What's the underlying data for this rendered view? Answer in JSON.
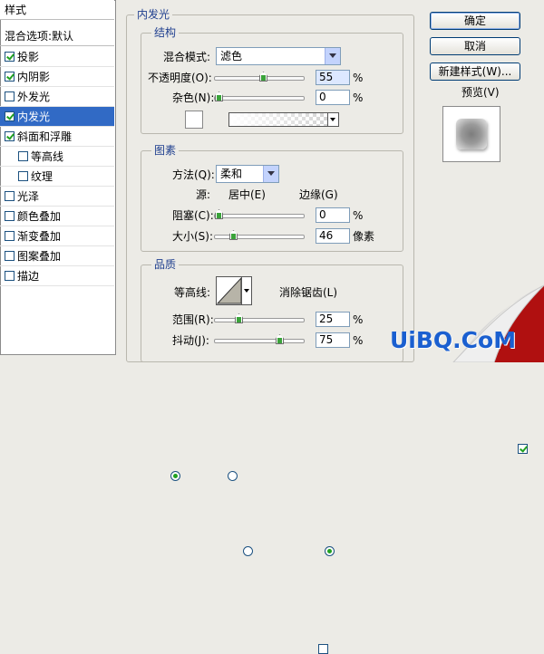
{
  "styles_panel": {
    "header": "样式",
    "items": [
      {
        "label": "混合选项:默认",
        "checkbox": false,
        "has_checkbox": false,
        "indent": false,
        "selected": false
      },
      {
        "label": "投影",
        "checkbox": true,
        "has_checkbox": true,
        "indent": false,
        "selected": false
      },
      {
        "label": "内阴影",
        "checkbox": true,
        "has_checkbox": true,
        "indent": false,
        "selected": false
      },
      {
        "label": "外发光",
        "checkbox": false,
        "has_checkbox": true,
        "indent": false,
        "selected": false
      },
      {
        "label": "内发光",
        "checkbox": true,
        "has_checkbox": true,
        "indent": false,
        "selected": true
      },
      {
        "label": "斜面和浮雕",
        "checkbox": true,
        "has_checkbox": true,
        "indent": false,
        "selected": false
      },
      {
        "label": "等高线",
        "checkbox": false,
        "has_checkbox": true,
        "indent": true,
        "selected": false
      },
      {
        "label": "纹理",
        "checkbox": false,
        "has_checkbox": true,
        "indent": true,
        "selected": false
      },
      {
        "label": "光泽",
        "checkbox": false,
        "has_checkbox": true,
        "indent": false,
        "selected": false
      },
      {
        "label": "颜色叠加",
        "checkbox": false,
        "has_checkbox": true,
        "indent": false,
        "selected": false
      },
      {
        "label": "渐变叠加",
        "checkbox": false,
        "has_checkbox": true,
        "indent": false,
        "selected": false
      },
      {
        "label": "图案叠加",
        "checkbox": false,
        "has_checkbox": true,
        "indent": false,
        "selected": false
      },
      {
        "label": "描边",
        "checkbox": false,
        "has_checkbox": true,
        "indent": false,
        "selected": false
      }
    ]
  },
  "inner_glow": {
    "title": "内发光",
    "structure": {
      "title": "结构",
      "blend_mode_label": "混合模式:",
      "blend_mode_value": "滤色",
      "opacity_label": "不透明度(O):",
      "opacity_value": "55",
      "opacity_unit": "%",
      "opacity_level": 0.55,
      "noise_label": "杂色(N):",
      "noise_value": "0",
      "noise_unit": "%",
      "noise_level": 0
    },
    "elements": {
      "title": "图素",
      "method_label": "方法(Q):",
      "method_value": "柔和",
      "source_label": "源:",
      "source_center": "居中(E)",
      "source_edge": "边缘(G)",
      "choke_label": "阻塞(C):",
      "choke_value": "0",
      "choke_unit": "%",
      "choke_level": 0,
      "size_label": "大小(S):",
      "size_value": "46",
      "size_unit": "像素",
      "size_level": 0.18
    },
    "quality": {
      "title": "品质",
      "contour_label": "等高线:",
      "antialias_label": "消除锯齿(L)",
      "range_label": "范围(R):",
      "range_value": "25",
      "range_unit": "%",
      "range_level": 0.25,
      "jitter_label": "抖动(J):",
      "jitter_value": "75",
      "jitter_unit": "%",
      "jitter_level": 0.75
    }
  },
  "buttons": {
    "ok": "确定",
    "cancel": "取消",
    "new_style": "新建样式(W)...",
    "preview": "预览(V)"
  },
  "watermark": "UiBQ.CoM"
}
